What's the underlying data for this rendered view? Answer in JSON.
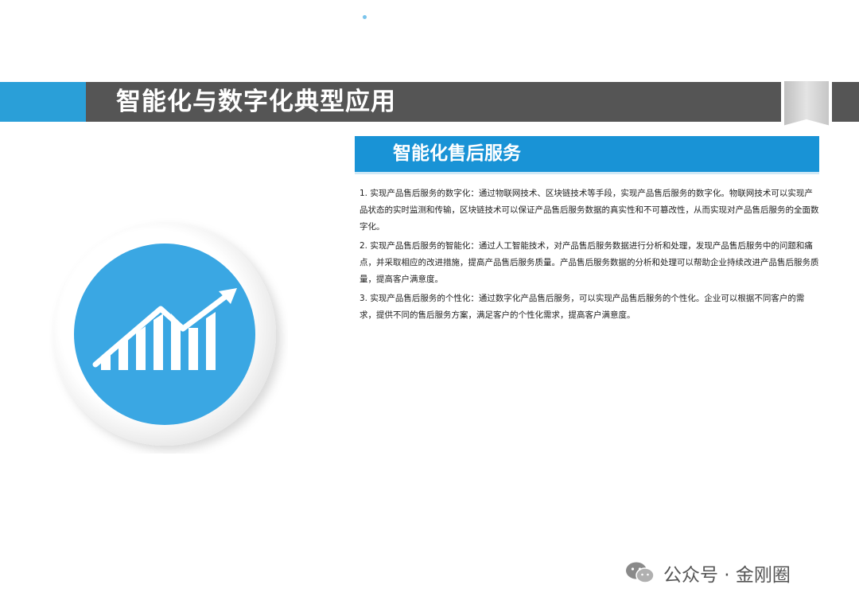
{
  "header": {
    "title": "智能化与数字化典型应用",
    "accent_color": "#2a9fd8",
    "bar_color": "#555555"
  },
  "section": {
    "title": "智能化售后服务",
    "color": "#1993d6"
  },
  "paragraphs": [
    "1. 实现产品售后服务的数字化：通过物联网技术、区块链技术等手段，实现产品售后服务的数字化。物联网技术可以实现产品状态的实时监测和传输，区块链技术可以保证产品售后服务数据的真实性和不可篡改性，从而实现对产品售后服务的全面数字化。",
    "2. 实现产品售后服务的智能化：通过人工智能技术，对产品售后服务数据进行分析和处理，发现产品售后服务中的问题和痛点，并采取相应的改进措施，提高产品售后服务质量。产品售后服务数据的分析和处理可以帮助企业持续改进产品售后服务质量，提高客户满意度。",
    "3. 实现产品售后服务的个性化：通过数字化产品售后服务，可以实现产品售后服务的个性化。企业可以根据不同客户的需求，提供不同的售后服务方案，满足客户的个性化需求，提高客户满意度。"
  ],
  "icon": {
    "name": "growth-chart-icon",
    "circle_color": "#3aa7e3"
  },
  "footer": {
    "label": "公众号 · 金刚圈",
    "icon": "wechat-icon"
  }
}
